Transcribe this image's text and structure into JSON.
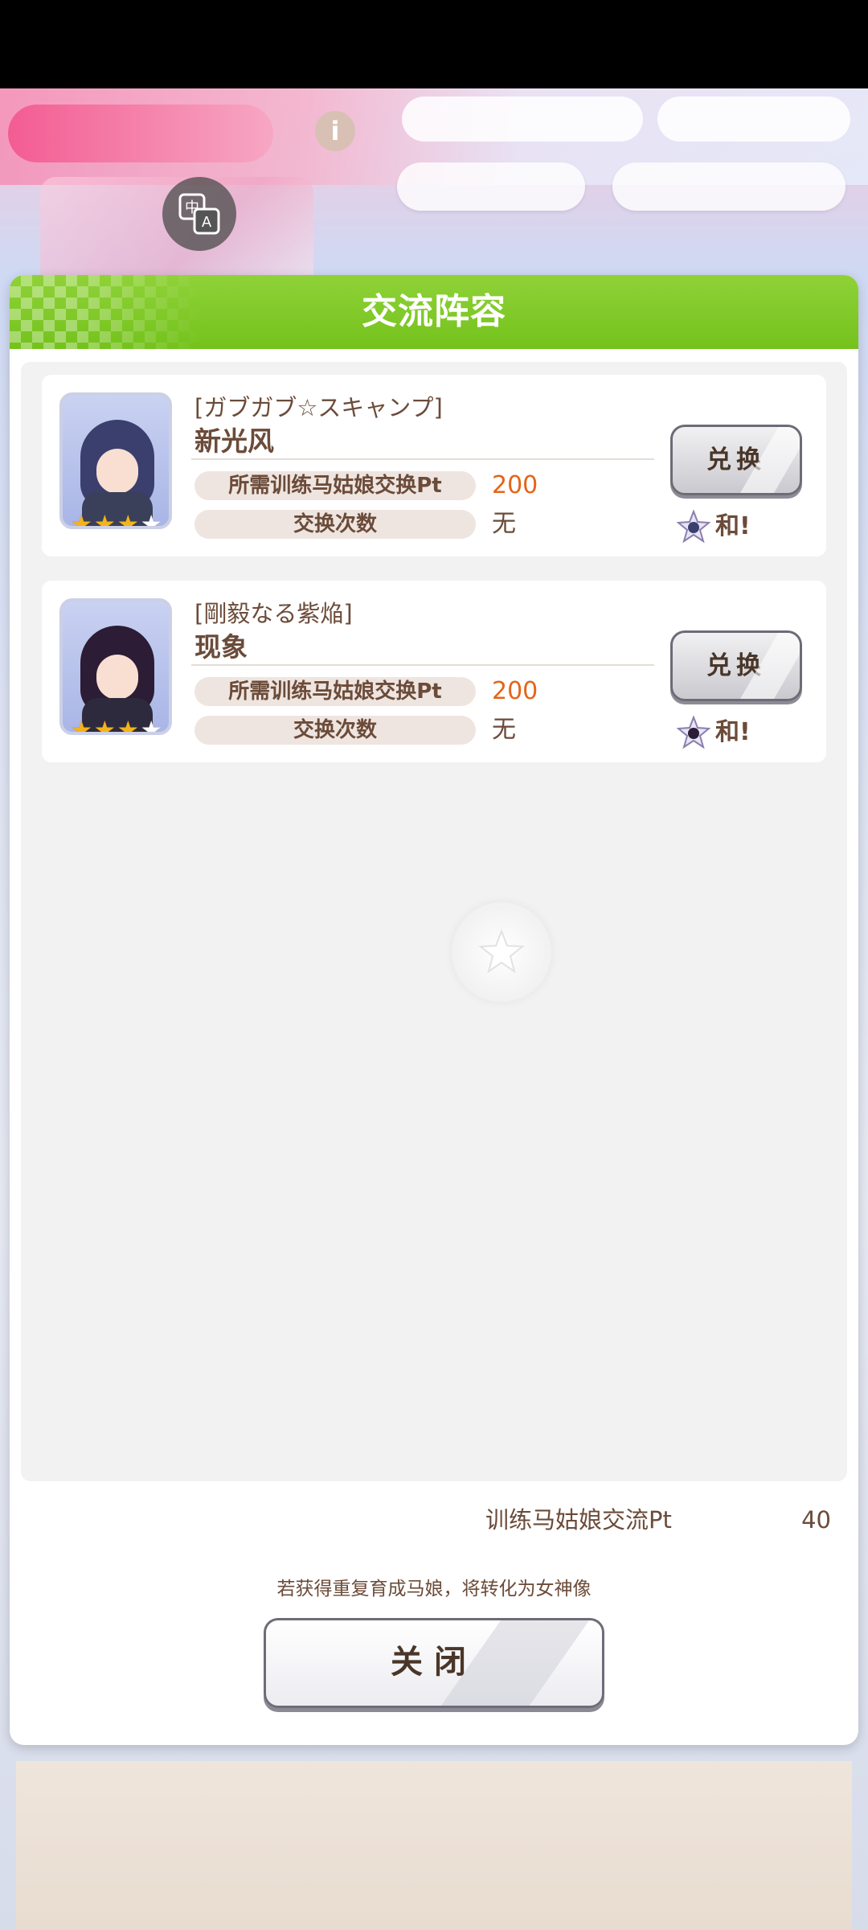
{
  "dialog": {
    "title": "交流阵容",
    "cards": [
      {
        "subtitle": "[ガブガブ☆スキャンプ]",
        "name": "新光风",
        "stars_filled": 3,
        "stars_total": 5,
        "cost_label": "所需训练马姑娘交换Pt",
        "cost_value": "200",
        "count_label": "交换次数",
        "count_value": "无",
        "button_label": "兑换",
        "goddess_label": "和!",
        "portrait_colors": {
          "hair": "#3b3f6e",
          "body": "#3a3f5a"
        }
      },
      {
        "subtitle": "[剛毅なる紫焔]",
        "name": "现象",
        "stars_filled": 3,
        "stars_total": 5,
        "cost_label": "所需训练马姑娘交换Pt",
        "cost_value": "200",
        "count_label": "交换次数",
        "count_value": "无",
        "button_label": "兑换",
        "goddess_label": "和!",
        "portrait_colors": {
          "hair": "#2c1c35",
          "body": "#2e2a3d"
        }
      }
    ],
    "pt_label": "训练马姑娘交流Pt",
    "pt_value": "40",
    "notice": "若获得重复育成马娘，将转化为女神像",
    "close_label": "关闭"
  },
  "colors": {
    "header_green": "#7fc825",
    "accent_orange": "#e5641a",
    "text_brown": "#6b4b39"
  },
  "icons": {
    "translate": "translate-icon",
    "goddess": "goddess-statue-icon",
    "loading": "star-loading-icon"
  }
}
